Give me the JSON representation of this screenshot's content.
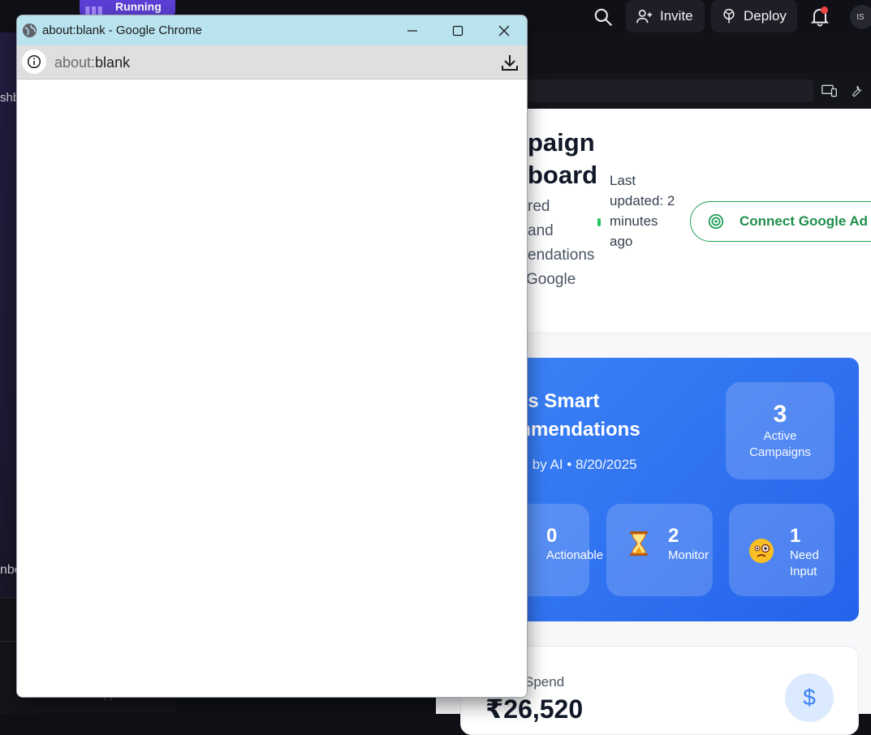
{
  "ide": {
    "running_label": "Running",
    "invite_label": "Invite",
    "deploy_label": "Deploy",
    "avatar_initials": "IS",
    "sidebar_partial_top": "shb",
    "sidebar_partial_bottom": "nbo"
  },
  "app": {
    "title_line1": "paign",
    "title_line2": "board",
    "subtitle_lines": [
      "red",
      "and",
      "endations",
      "Google"
    ],
    "last_updated": "Last updated: 2 minutes ago",
    "connect_button": "Connect Google Ad",
    "hero": {
      "title_line1": "ay's Smart",
      "title_line2": "ommendations",
      "generated": "ated by AI • 8/20/2025",
      "active_count": "3",
      "active_label": "Active Campaigns",
      "stats": [
        {
          "value": "0",
          "label": "Actionable",
          "icon": "check-emoji"
        },
        {
          "value": "2",
          "label": "Monitor",
          "icon": "hourglass-emoji"
        },
        {
          "value": "1",
          "label": "Need Input",
          "icon": "monocle-face-emoji"
        }
      ]
    },
    "spend": {
      "label": "Spend",
      "value": "₹26,520",
      "icon": "dollar-icon"
    }
  },
  "popup": {
    "title": "about:blank - Google Chrome",
    "url_scheme": "about:",
    "url_rest": "blank"
  }
}
